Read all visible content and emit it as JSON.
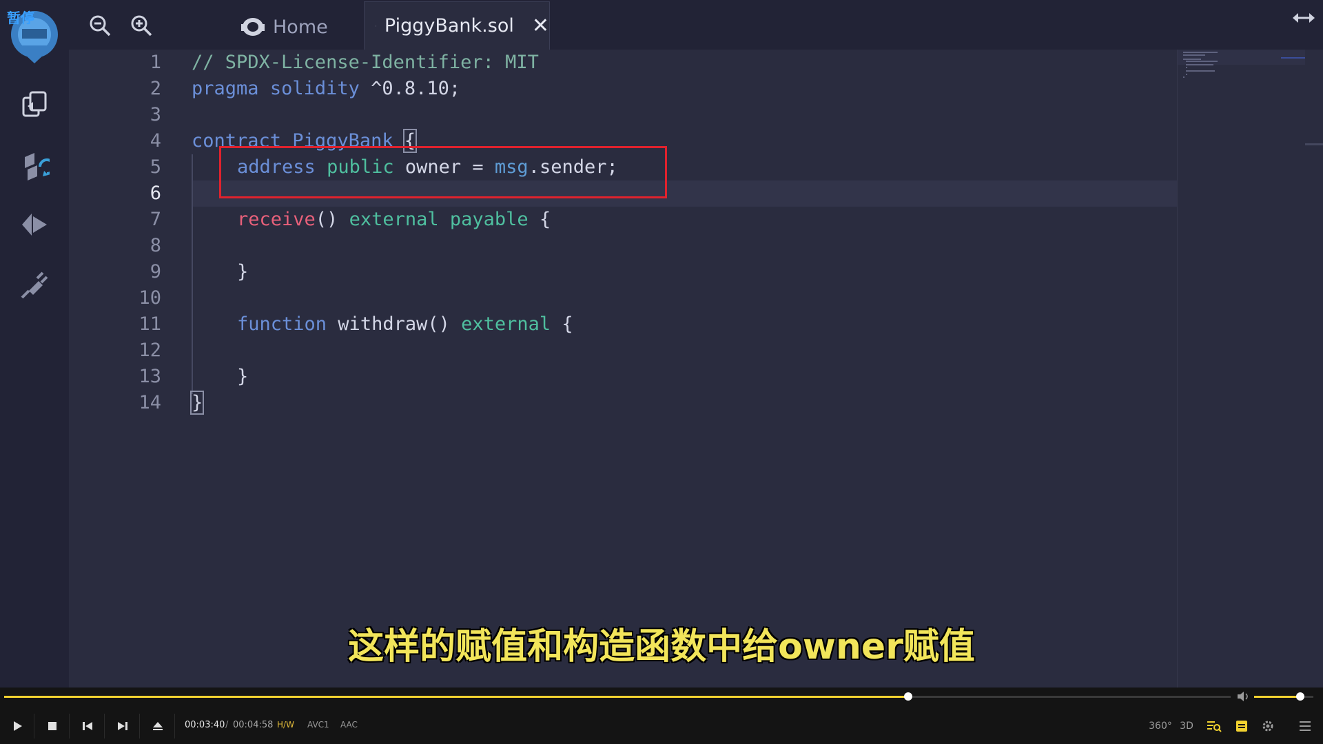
{
  "overlay": {
    "pause_label": "暂停"
  },
  "tabs": {
    "home_label": "Home",
    "active_label": "PiggyBank.sol",
    "close_glyph": "✕"
  },
  "editor": {
    "line_numbers": [
      "1",
      "2",
      "3",
      "4",
      "5",
      "6",
      "7",
      "8",
      "9",
      "10",
      "11",
      "12",
      "13",
      "14"
    ],
    "current_line": "6",
    "code": {
      "l1": "// SPDX-License-Identifier: MIT",
      "l2_kw1": "pragma",
      "l2_kw2": "solidity",
      "l2_ver": " ^0.8.10;",
      "l4_kw": "contract",
      "l4_name": " PiggyBank ",
      "l4_brace": "{",
      "l5_type": "address",
      "l5_vis": "public",
      "l5_name": " owner = ",
      "l5_msg": "msg",
      "l5_rest": ".sender;",
      "l7_fn": "receive",
      "l7_paren": "() ",
      "l7_ext": "external",
      "l7_pay": "payable",
      "l7_brace": " {",
      "l9": "}",
      "l11_kw": "function",
      "l11_name": " withdraw() ",
      "l11_ext": "external",
      "l11_brace": " {",
      "l13": "}",
      "l14": "}"
    }
  },
  "subtitle": "这样的赋值和构造函数中给owner赋值",
  "player": {
    "time_current": "00:03:40",
    "time_separator": "/",
    "time_total": "00:04:58",
    "progress": 0.737,
    "volume": 0.78,
    "badges": [
      "H/W",
      "AVC1",
      "AAC"
    ],
    "right_labels": {
      "vr": "360°",
      "three_d": "3D"
    }
  },
  "colors": {
    "accent": "#f2d230",
    "highlight_box": "#e0222d",
    "subtitle": "#f2e55a"
  },
  "icons": [
    "logo-icon",
    "file-explorer-icon",
    "compile-icon",
    "deploy-icon",
    "plugin-icon",
    "zoom-out-icon",
    "zoom-in-icon",
    "home-icon",
    "solidity-file-icon",
    "close-icon",
    "expand-icon",
    "play-icon",
    "stop-icon",
    "previous-icon",
    "next-icon",
    "eject-icon",
    "volume-icon",
    "vr-icon",
    "3d-icon",
    "playlist-icon",
    "subtitle-icon",
    "settings-icon",
    "menu-icon"
  ]
}
